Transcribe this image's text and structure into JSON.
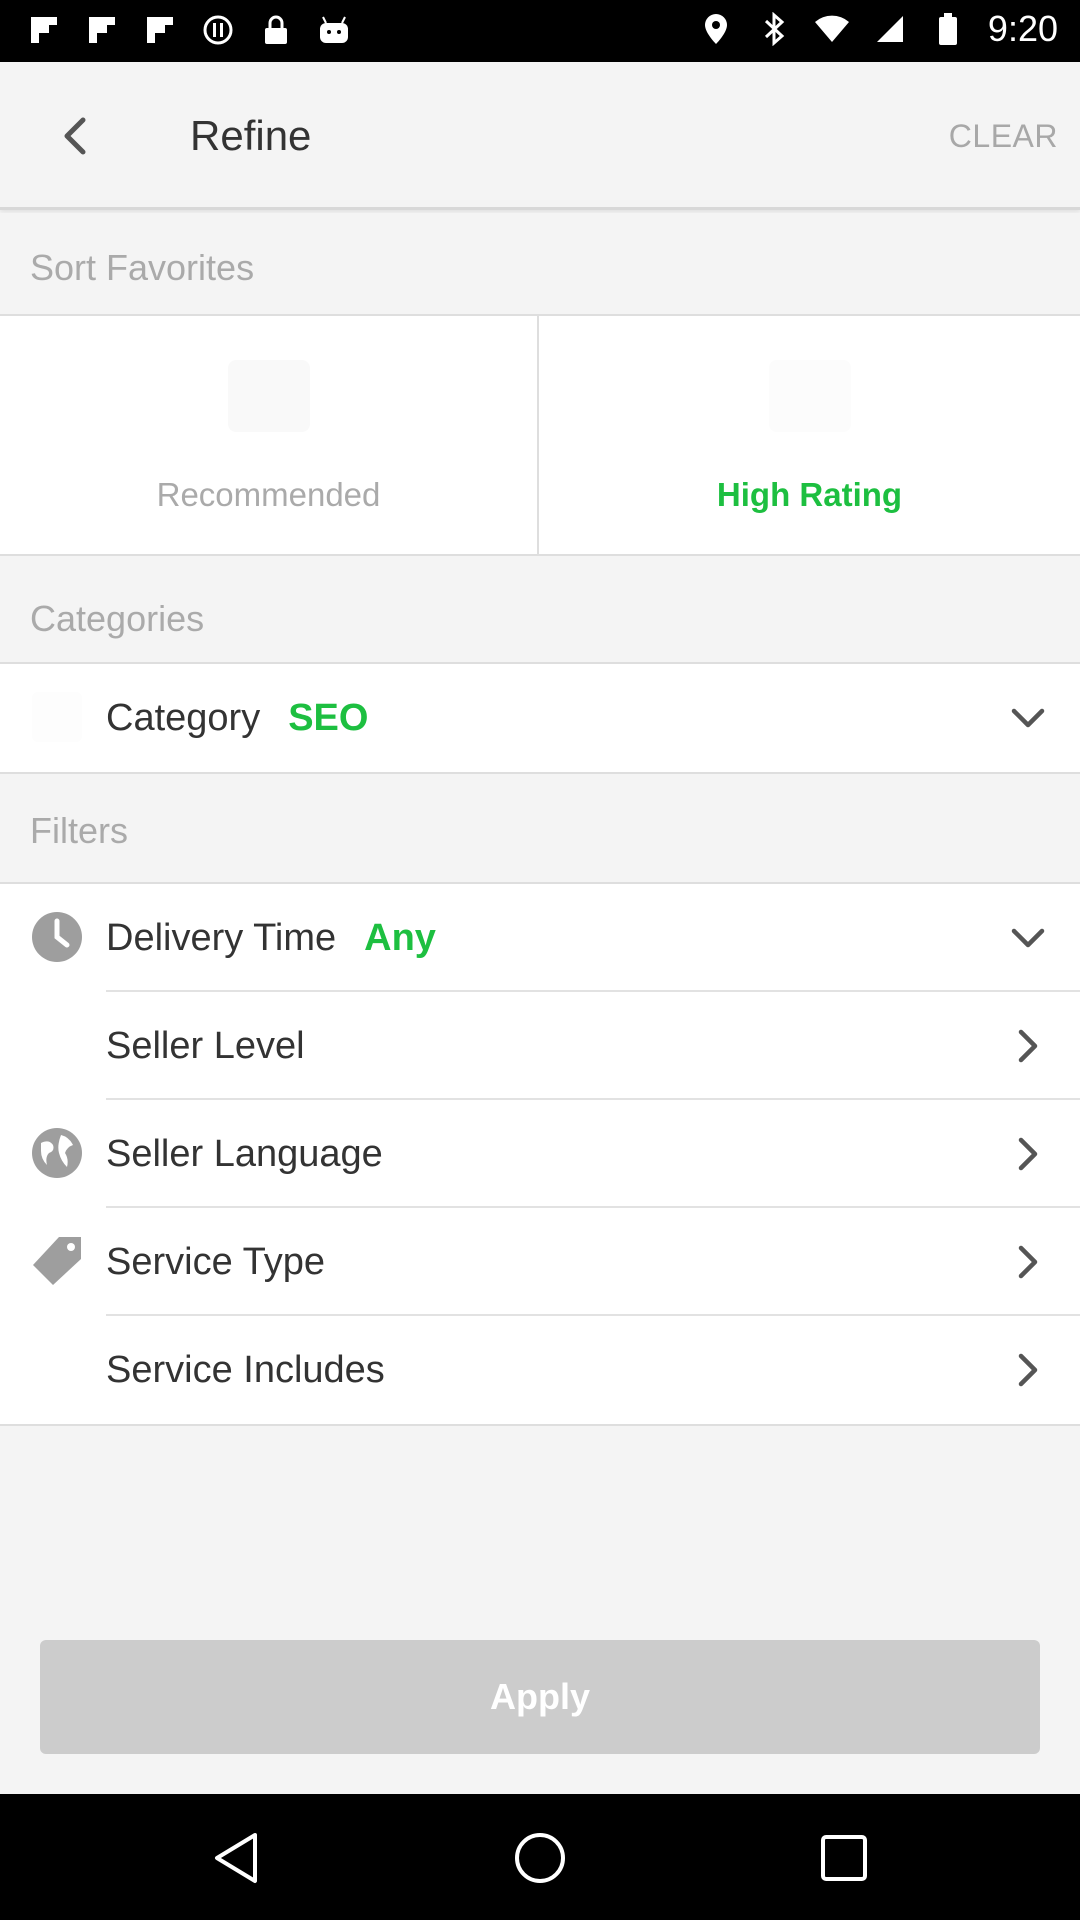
{
  "status_bar": {
    "time": "9:20"
  },
  "toolbar": {
    "title": "Refine",
    "clear_label": "CLEAR"
  },
  "sections": {
    "sort": "Sort Favorites",
    "categories": "Categories",
    "filters": "Filters"
  },
  "sort_options": [
    {
      "label": "Recommended",
      "selected": false
    },
    {
      "label": "High Rating",
      "selected": true
    }
  ],
  "category": {
    "label": "Category",
    "value": "SEO"
  },
  "filters": [
    {
      "label": "Delivery Time",
      "value": "Any",
      "icon": "clock-icon",
      "chevron": "chevron-down-icon"
    },
    {
      "label": "Seller Level",
      "value": "",
      "icon": "",
      "chevron": "chevron-right-icon"
    },
    {
      "label": "Seller Language",
      "value": "",
      "icon": "globe-icon",
      "chevron": "chevron-right-icon"
    },
    {
      "label": "Service Type",
      "value": "",
      "icon": "tag-icon",
      "chevron": "chevron-right-icon"
    },
    {
      "label": "Service Includes",
      "value": "",
      "icon": "",
      "chevron": "chevron-right-icon"
    }
  ],
  "apply_label": "Apply",
  "colors": {
    "accent": "#1dbf40",
    "muted": "#aaaaaa",
    "button_disabled": "#cccccc"
  }
}
